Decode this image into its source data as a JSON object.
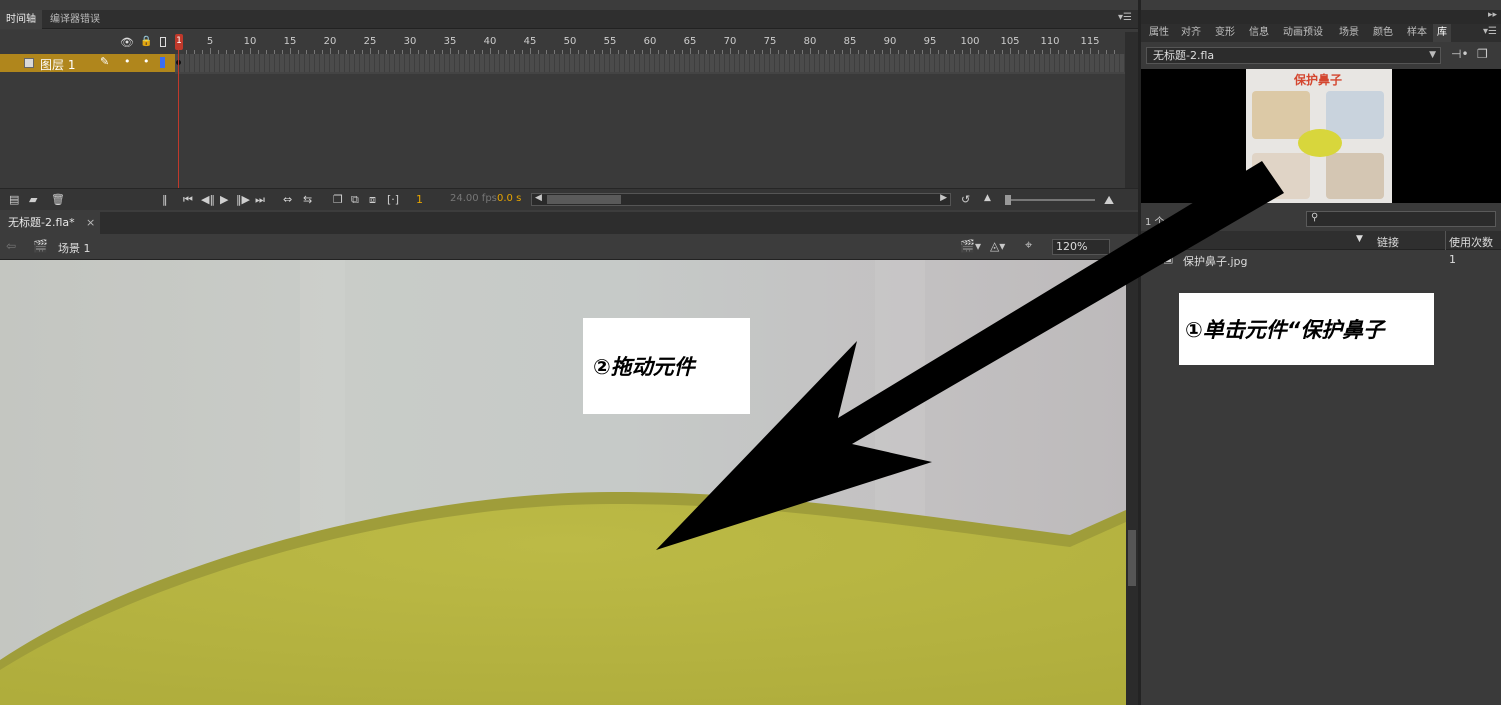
{
  "timeline": {
    "tabs": [
      "时间轴",
      "编译器错误"
    ],
    "ruler_numbers": [
      "1",
      "5",
      "10",
      "15",
      "20",
      "25",
      "30",
      "35",
      "40",
      "45",
      "50",
      "55",
      "60",
      "65",
      "70",
      "75",
      "80",
      "85",
      "90",
      "95",
      "100",
      "105",
      "110",
      "115"
    ],
    "layer_name": "图层 1",
    "current_frame": "1",
    "fps": "24.00 fps",
    "time": "0.0 s"
  },
  "document": {
    "tab_label": "无标题-2.fla*",
    "close_glyph": "×",
    "scene_label": "场景 1",
    "zoom": "120%"
  },
  "right_panel": {
    "tabs": [
      "属性",
      "对齐",
      "变形",
      "信息",
      "动画预设",
      "场景",
      "颜色",
      "样本",
      "库"
    ],
    "active_tab": "库",
    "library_document": "无标题-2.fla",
    "thumbnail_title": "保护鼻子",
    "item_count": "1 个",
    "columns": {
      "linkage": "链接",
      "use_count": "使用次数"
    },
    "items": [
      {
        "name": "保护鼻子.jpg",
        "use_count": "1"
      }
    ]
  },
  "annotations": {
    "step1": "①单击元件“保护鼻子",
    "step2": "②拖动元件"
  },
  "colors": {
    "layer_highlight": "#b0861c",
    "playhead": "#c0392b",
    "stage_wall": "#c7c9c5",
    "stage_table": "#b6b441"
  }
}
